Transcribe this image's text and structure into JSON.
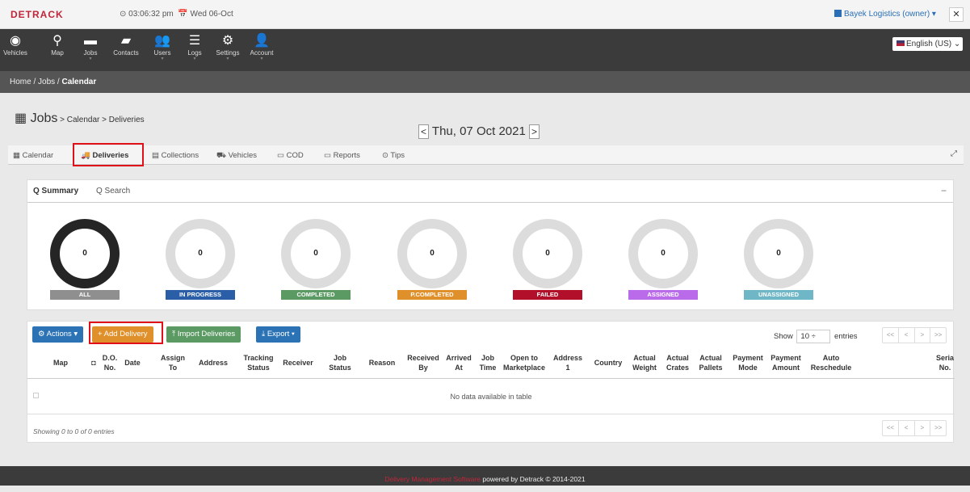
{
  "app": {
    "logo": "DETRACK",
    "time": "⊙ 03:06:32 pm",
    "date": "📅 Wed 06-Oct",
    "owner": "Bayek Logistics (owner) ▾",
    "fullscreen": "✕"
  },
  "nav": [
    {
      "icon": "◉",
      "label": "Vehicles"
    },
    {
      "icon": "⚲",
      "label": "Map"
    },
    {
      "icon": "▬",
      "label": "Jobs",
      "caret": true
    },
    {
      "icon": "▰",
      "label": "Contacts"
    },
    {
      "icon": "👥",
      "label": "Users",
      "caret": true
    },
    {
      "icon": "☰",
      "label": "Logs",
      "caret": true
    },
    {
      "icon": "⚙",
      "label": "Settings",
      "caret": true
    },
    {
      "icon": "👤",
      "label": "Account",
      "caret": true
    }
  ],
  "language": "English (US) ⌄",
  "breadcrumb": {
    "prefix": "Home / Jobs / ",
    "current": "Calendar"
  },
  "page": {
    "title": "Jobs",
    "subtitle": " > Calendar > Deliveries",
    "date": "Thu, 07 Oct 2021",
    "prev": "<",
    "next": ">",
    "calendar_icon": "▦"
  },
  "tabs": [
    {
      "label": "▦ Calendar"
    },
    {
      "label": "🚚 Deliveries",
      "active": true
    },
    {
      "label": "▤ Collections"
    },
    {
      "label": "⛟ Vehicles"
    },
    {
      "label": "▭ COD"
    },
    {
      "label": "▭ Reports"
    },
    {
      "label": "⊙ Tips"
    }
  ],
  "expand": "⤢",
  "panel": {
    "tabs": [
      {
        "label": "Q Summary",
        "active": true
      },
      {
        "label": "Q Search"
      }
    ],
    "collapse": "−"
  },
  "statuses": [
    {
      "label": "ALL",
      "count": "0",
      "color": "#8f8f8f"
    },
    {
      "label": "IN PROGRESS",
      "count": "0",
      "color": "#2a5fa8"
    },
    {
      "label": "COMPLETED",
      "count": "0",
      "color": "#5b9a63"
    },
    {
      "label": "P.COMPLETED",
      "count": "0",
      "color": "#e0902a"
    },
    {
      "label": "FAILED",
      "count": "0",
      "color": "#b2102a"
    },
    {
      "label": "ASSIGNED",
      "count": "0",
      "color": "#b96bea"
    },
    {
      "label": "UNASSIGNED",
      "count": "0",
      "color": "#6fb6c7"
    }
  ],
  "toolbar": {
    "actions": "⚙ Actions ▾",
    "add": "+ Add Delivery",
    "import": "⤒ Import Deliveries",
    "export": "⤓ Export ▾",
    "show": "Show",
    "entries_value": "10 ÷",
    "entries": "entries"
  },
  "pager": [
    "<<",
    "<",
    ">",
    ">>"
  ],
  "columns": [
    "Map",
    "",
    "D.O.\nNo.",
    "Date",
    "Assign\nTo",
    "Address",
    "Tracking\nStatus",
    "Receiver",
    "Job\nStatus",
    "Reason",
    "Received\nBy",
    "Arrived\nAt",
    "Job\nTime",
    "Open to\nMarketplace",
    "Address\n1",
    "Country",
    "Actual\nWeight",
    "Actual\nCrates",
    "Actual\nPallets",
    "Payment\nMode",
    "Payment\nAmount",
    "Auto\nReschedule",
    "Seria\nNo."
  ],
  "nodata": "No data available in table",
  "showing": "Showing 0 to 0 of 0 entries",
  "footer": {
    "red": "Delivery Management Software",
    "rest": " powered by Detrack © 2014-2021"
  }
}
